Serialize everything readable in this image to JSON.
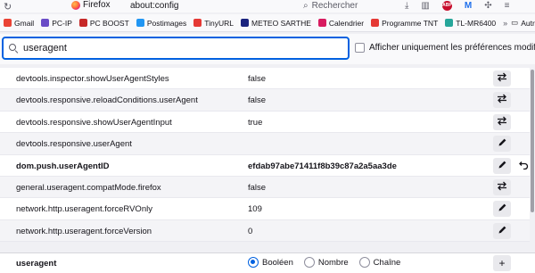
{
  "browser": {
    "tab_title": "Firefox",
    "url": "about:config",
    "search_placeholder": "Rechercher",
    "abp_label": "ABP",
    "ext_m_label": "M"
  },
  "bookmarks": [
    {
      "label": "Gmail",
      "color": "#ea4335"
    },
    {
      "label": "PC-IP",
      "color": "#6a4cc7"
    },
    {
      "label": "PC BOOST",
      "color": "#c62828"
    },
    {
      "label": "Postimages",
      "color": "#2196f3"
    },
    {
      "label": "TinyURL",
      "color": "#e53935"
    },
    {
      "label": "METEO SARTHE",
      "color": "#1a237e"
    },
    {
      "label": "Calendrier",
      "color": "#d81b60"
    },
    {
      "label": "Programme TNT",
      "color": "#e53935"
    },
    {
      "label": "TL-MR6400",
      "color": "#26a69a"
    }
  ],
  "bookmarks_other": "Autres marque-pages",
  "filter": {
    "value": "useragent",
    "modified_only_label": "Afficher uniquement les préférences modifiées"
  },
  "prefs": [
    {
      "name": "devtools.inspector.showUserAgentStyles",
      "value": "false",
      "action": "toggle",
      "modified": false
    },
    {
      "name": "devtools.responsive.reloadConditions.userAgent",
      "value": "false",
      "action": "toggle",
      "modified": false
    },
    {
      "name": "devtools.responsive.showUserAgentInput",
      "value": "true",
      "action": "toggle",
      "modified": false
    },
    {
      "name": "devtools.responsive.userAgent",
      "value": "",
      "action": "edit",
      "modified": false
    },
    {
      "name": "dom.push.userAgentID",
      "value": "efdab97abe71411f8b39c87a2a5aa3de",
      "action": "edit",
      "modified": true
    },
    {
      "name": "general.useragent.compatMode.firefox",
      "value": "false",
      "action": "toggle",
      "modified": false
    },
    {
      "name": "network.http.useragent.forceRVOnly",
      "value": "109",
      "action": "edit",
      "modified": false
    },
    {
      "name": "network.http.useragent.forceVersion",
      "value": "0",
      "action": "edit",
      "modified": false
    }
  ],
  "add_row": {
    "name": "useragent",
    "types": [
      "Booléen",
      "Nombre",
      "Chaîne"
    ],
    "selected": "Booléen",
    "add_label": "+"
  },
  "colors": {
    "accent": "#0061e0",
    "button_bg": "#e9e9ed"
  }
}
